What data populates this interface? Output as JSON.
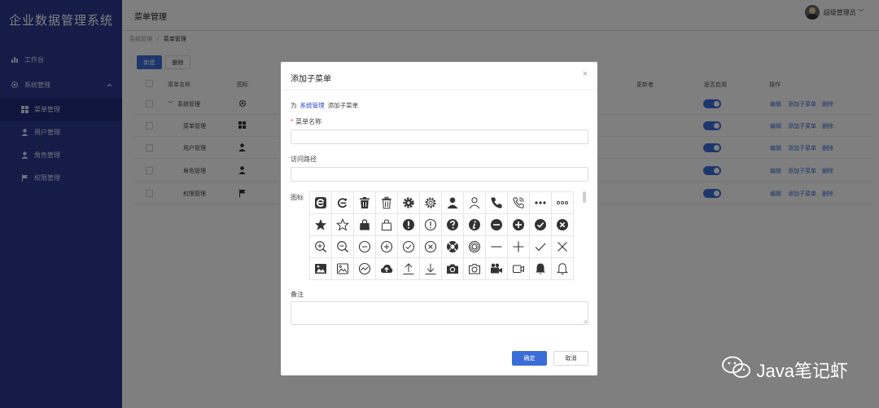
{
  "app": {
    "title": "企业数据管理系统"
  },
  "sidebar": {
    "items": [
      {
        "label": "工作台",
        "icon": "bar-chart-icon"
      },
      {
        "label": "系统管理",
        "icon": "gear-icon",
        "expanded": true
      },
      {
        "label": "菜单管理",
        "icon": "grid-icon",
        "active": true
      },
      {
        "label": "用户管理",
        "icon": "user-icon"
      },
      {
        "label": "角色管理",
        "icon": "user-icon"
      },
      {
        "label": "权限管理",
        "icon": "flag-icon"
      }
    ]
  },
  "header": {
    "title": "菜单管理",
    "user_name": "超级管理员 ﹀"
  },
  "breadcrumb": {
    "parent": "系统管理",
    "sep": "/",
    "current": "菜单管理"
  },
  "toolbar": {
    "new_label": "新建",
    "delete_label": "删除"
  },
  "table": {
    "columns": [
      "菜单名称",
      "图标",
      "更新者",
      "是否启用",
      "操作"
    ],
    "rows": [
      {
        "name": "系统管理",
        "icon": "gear-icon",
        "tree": "﹀"
      },
      {
        "name": "菜单管理",
        "icon": "grid-icon"
      },
      {
        "name": "用户管理",
        "icon": "user-icon"
      },
      {
        "name": "角色管理",
        "icon": "user-icon"
      },
      {
        "name": "权限管理",
        "icon": "flag-icon"
      }
    ],
    "actions": {
      "edit": "编辑",
      "add_child": "添加子菜单",
      "delete": "删除"
    }
  },
  "modal": {
    "title": "添加子菜单",
    "close": "×",
    "context_prefix": "为",
    "context_target": "系统管理",
    "context_suffix": "添加子菜单",
    "required_mark": "*",
    "name_label": "菜单名称",
    "path_label": "访问路径",
    "icon_label": "图标",
    "remark_label": "备注",
    "confirm_label": "确定",
    "cancel_label": "取消"
  },
  "icon_grid": [
    "edge-solid-icon",
    "edge-icon",
    "trash-solid-icon",
    "trash-icon",
    "gear-solid-icon",
    "gear-icon",
    "user-solid-icon",
    "user-icon",
    "phone-solid-icon",
    "phone-ring-icon",
    "more-solid-icon",
    "more-icon",
    "star-solid-icon",
    "star-icon",
    "bag-solid-icon",
    "bag-icon",
    "warning-solid-icon",
    "warning-icon",
    "question-solid-icon",
    "info-solid-icon",
    "minus-circle-solid-icon",
    "plus-circle-solid-icon",
    "check-circle-solid-icon",
    "close-circle-solid-icon",
    "zoom-in-icon",
    "zoom-out-icon",
    "minus-circle-icon",
    "plus-circle-icon",
    "check-circle-icon",
    "close-circle-icon",
    "lifebuoy-solid-icon",
    "lifebuoy-icon",
    "minus-icon",
    "plus-icon",
    "check-icon",
    "close-icon",
    "picture-solid-icon",
    "picture-icon",
    "chart-circle-icon",
    "cloud-upload-solid-icon",
    "upload-icon",
    "download-icon",
    "camera-solid-icon",
    "camera-icon",
    "video-solid-icon",
    "video-icon",
    "bell-solid-icon",
    "bell-icon"
  ],
  "watermark": {
    "text": "Java笔记虾"
  }
}
